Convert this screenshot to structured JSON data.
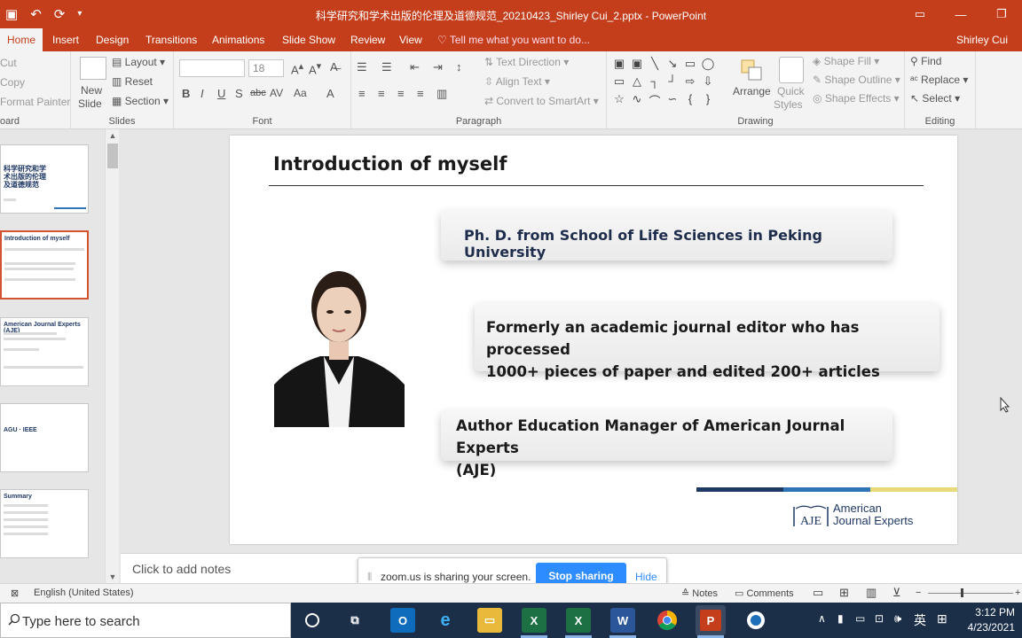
{
  "titlebar": {
    "title": "科学研究和学术出版的伦理及道德规范_20210423_Shirley Cui_2.pptx - PowerPoint",
    "qat_icons": [
      "save-icon",
      "undo-icon",
      "redo-icon",
      "customize-icon"
    ]
  },
  "tabs": {
    "items": [
      "Home",
      "Insert",
      "Design",
      "Transitions",
      "Animations",
      "Slide Show",
      "Review",
      "View"
    ],
    "active": "Home",
    "tell_me": "Tell me what you want to do...",
    "user": "Shirley Cui"
  },
  "ribbon": {
    "clipboard": {
      "cut": "Cut",
      "copy": "Copy",
      "format_painter": "Format Painter",
      "label": "oard"
    },
    "slides": {
      "new_slide": "New",
      "new_slide2": "Slide",
      "layout": "Layout",
      "reset": "Reset",
      "section": "Section",
      "label": "Slides"
    },
    "font": {
      "size": "18",
      "label": "Font"
    },
    "paragraph": {
      "text_direction": "Text Direction",
      "align_text": "Align Text",
      "smartart": "Convert to SmartArt",
      "label": "Paragraph"
    },
    "drawing": {
      "arrange": "Arrange",
      "quick_styles": "Quick",
      "quick_styles2": "Styles",
      "shape_fill": "Shape Fill",
      "shape_outline": "Shape Outline",
      "shape_effects": "Shape Effects",
      "label": "Drawing"
    },
    "editing": {
      "find": "Find",
      "replace": "Replace",
      "select": "Select",
      "label": "Editing"
    }
  },
  "thumbnails": [
    {
      "title": "科学研究和学术出版的伦理及道德规范"
    },
    {
      "title": "Introduction of myself"
    },
    {
      "title": "American Journal Experts (AJE)"
    },
    {
      "title": "AGU · IEEE"
    },
    {
      "title": "Summary"
    }
  ],
  "slide": {
    "title": "Introduction of myself",
    "callout1": "Ph. D. from School of Life Sciences in Peking University",
    "callout2_line1": "Formerly an academic journal editor who has processed",
    "callout2_line2": "1000+ pieces of paper and edited 200+ articles",
    "callout3_line1": "Author Education Manager of American Journal Experts",
    "callout3_line2": "(AJE)",
    "logo_mark": "AJE",
    "logo_line1": "American",
    "logo_line2": "Journal Experts",
    "brand_colors": [
      "#1f3864",
      "#2e75b6",
      "#e8d97a"
    ]
  },
  "notes": {
    "placeholder": "Click to add notes"
  },
  "zoom": {
    "message": "zoom.us is sharing your screen.",
    "stop": "Stop sharing",
    "hide": "Hide"
  },
  "statusbar": {
    "language": "English (United States)",
    "notes": "Notes",
    "comments": "Comments"
  },
  "taskbar": {
    "search_placeholder": "Type here to search",
    "apps": [
      "cortana-icon",
      "task-view-icon",
      "outlook-icon",
      "edge-icon",
      "file-explorer-icon",
      "excel-icon",
      "excel-icon",
      "word-icon",
      "chrome-icon",
      "powerpoint-icon",
      "app-icon"
    ],
    "ime": "英",
    "time": "3:12 PM",
    "date": "4/23/2021"
  }
}
